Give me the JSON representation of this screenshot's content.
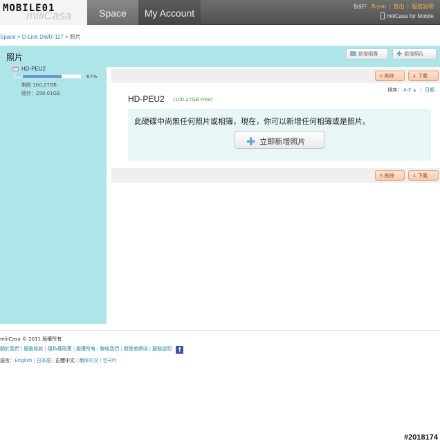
{
  "header": {
    "logo_mobile": "MOBILE01",
    "logo_brand": "miiiCasa",
    "tabs": [
      {
        "label": "Space"
      },
      {
        "label": "My Account"
      }
    ],
    "greeting": "你好！",
    "user": "Bryan",
    "logout": "登出",
    "help": "服務說明",
    "mobile_link": "miiiCasa for Mobile"
  },
  "breadcrumb": {
    "root": "Space",
    "device": "D-Link DWR-117",
    "current": "照片"
  },
  "page": {
    "title": "照片",
    "new_album": "新增相簿",
    "new_photo": "新增照片"
  },
  "sidebar": {
    "drive_name": "HD-PEU2",
    "usage_percent": 67,
    "usage_label": "67%",
    "remaining": "剩餘 100.27GB",
    "total": "總計：298.01GB"
  },
  "content": {
    "delete": "刪除",
    "download": "下載",
    "sort_label": "排序：",
    "sort_az": "A-Z",
    "sort_date": "日期",
    "disk_title": "HD-PEU2",
    "free_space": "(100.27GB Free)",
    "empty_message": "此硬碟中尚無任何照片或相簿，現在，你可以新增任何相簿或是照片。",
    "add_now": "立即新增照片"
  },
  "footer": {
    "copyright": "miiiCasa © 2011   版權所有",
    "links": [
      "關於我們",
      "服務條款",
      "隱私權政策",
      "版權所有",
      "聯絡我們",
      "開發者網站",
      "服務說明"
    ],
    "facebook_icon": "f",
    "language_label": "語言：",
    "languages": [
      "English",
      "日本語",
      "正體中文",
      "簡体中文",
      "한국어"
    ]
  },
  "watermark": "#2018174"
}
